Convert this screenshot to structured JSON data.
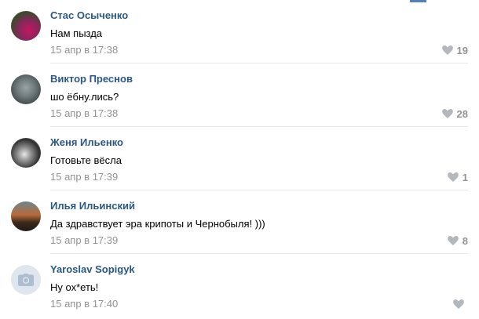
{
  "comments": [
    {
      "author": "Стас Осыченко",
      "text": "Нам пызда",
      "date": "15 апр в 17:38",
      "likes": "19"
    },
    {
      "author": "Виктор Преснов",
      "text": "шо ёбну.лись?",
      "date": "15 апр в 17:38",
      "likes": "28"
    },
    {
      "author": "Женя Ильенко",
      "text": "Готовьте вёсла",
      "date": "15 апр в 17:39",
      "likes": "1"
    },
    {
      "author": "Илья Ильинский",
      "text": "Да здравствует эра крипоты и Чернобыля! )))",
      "date": "15 апр в 17:39",
      "likes": "8"
    },
    {
      "author": "Yaroslav Sopigyk",
      "text": "Ну ох*еть!",
      "date": "15 апр в 17:40",
      "likes": ""
    }
  ],
  "icons": {
    "like": "heart-icon",
    "avatar_placeholder": "camera-icon"
  },
  "colors": {
    "author": "#2a5885",
    "meta": "#939393",
    "like": "#b3b8bf",
    "divider": "#e7e8ec",
    "accent": "#5181b8"
  }
}
